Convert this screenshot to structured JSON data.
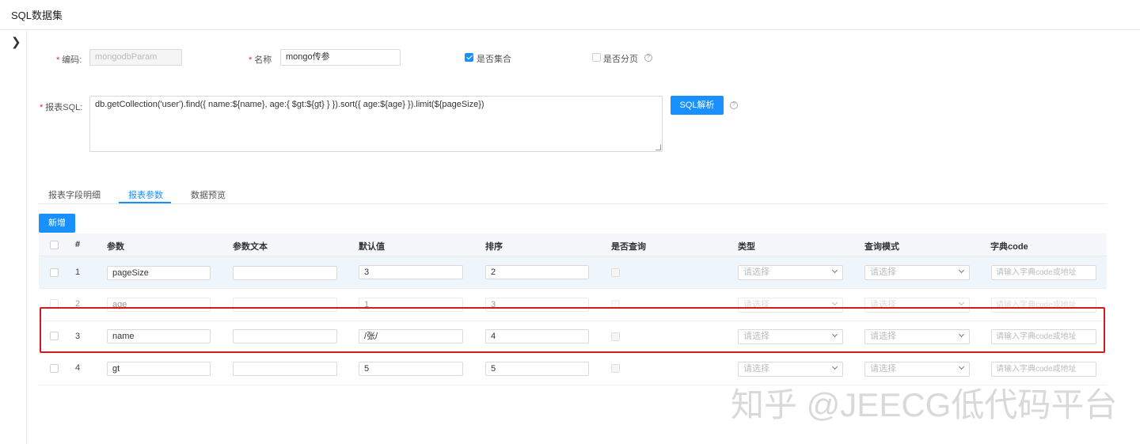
{
  "page": {
    "title": "SQL数据集"
  },
  "form": {
    "code_label": "编码:",
    "code_value": "mongodbParam",
    "name_label": "名称",
    "name_value": "mongo传参",
    "is_list_label": "是否集合",
    "is_page_label": "是否分页",
    "sql_label": "报表SQL:",
    "sql_value": "db.getCollection('user').find({ name:${name}, age:{ $gt:${gt} } }).sort({ age:${age} }).limit(${pageSize})",
    "parse_button": "SQL解析",
    "help_glyph": "?"
  },
  "tabs": [
    {
      "label": "报表字段明细"
    },
    {
      "label": "报表参数"
    },
    {
      "label": "数据预览"
    }
  ],
  "toolbar": {
    "add_label": "新增"
  },
  "table": {
    "headers": {
      "index": "#",
      "param": "参数",
      "text": "参数文本",
      "default": "默认值",
      "order": "排序",
      "query": "是否查询",
      "type": "类型",
      "mode": "查询模式",
      "dict": "字典code"
    },
    "select_placeholder": "请选择",
    "dict_placeholder": "请输入字典code或地址",
    "rows": [
      {
        "index": "1",
        "param": "pageSize",
        "text": "",
        "default": "3",
        "order": "2"
      },
      {
        "index": "2",
        "param": "age",
        "text": "",
        "default": "1",
        "order": "3"
      },
      {
        "index": "3",
        "param": "name",
        "text": "",
        "default": "/张/",
        "order": "4"
      },
      {
        "index": "4",
        "param": "gt",
        "text": "",
        "default": "5",
        "order": "5"
      }
    ]
  },
  "watermark": "知乎 @JEECG低代码平台",
  "colors": {
    "primary": "#1890ff",
    "highlight_border": "#d21c1c",
    "row_highlight": "#eef6fc"
  }
}
